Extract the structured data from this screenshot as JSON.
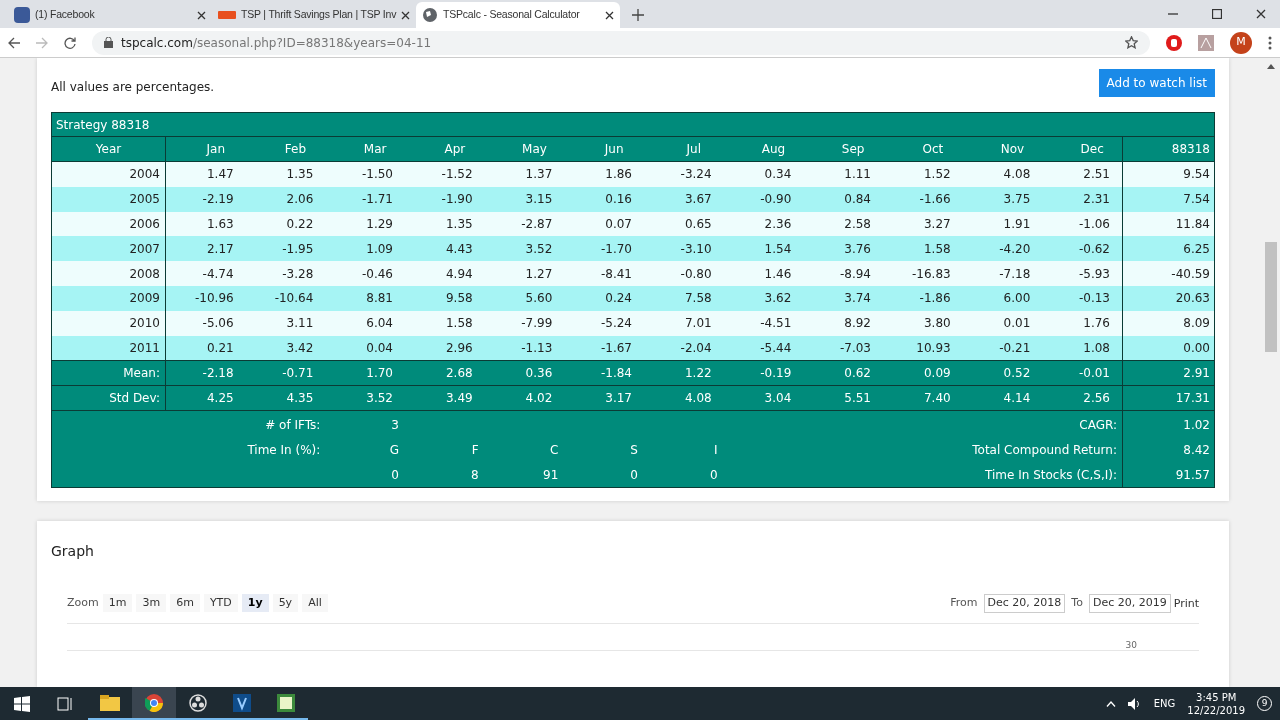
{
  "browser": {
    "tabs": [
      {
        "title": "(1) Facebook",
        "kind": "facebook",
        "selected": false
      },
      {
        "title": "TSP | Thrift Savings Plan | TSP Inv",
        "kind": "tsp",
        "selected": false
      },
      {
        "title": "TSPcalc - Seasonal Calculator",
        "kind": "globe",
        "selected": true
      }
    ],
    "url_host": "tspcalc.com",
    "url_path": "/seasonal.php?ID=88318&years=04-11",
    "profile": "M"
  },
  "page": {
    "note": "All values are percentages.",
    "watch_button": "Add to watch list",
    "table": {
      "title": "Strategy 88318",
      "columns": [
        "Year",
        "Jan",
        "Feb",
        "Mar",
        "Apr",
        "May",
        "Jun",
        "Jul",
        "Aug",
        "Sep",
        "Oct",
        "Nov",
        "Dec",
        "88318"
      ],
      "rows": [
        [
          "2004",
          "1.47",
          "1.35",
          "-1.50",
          "-1.52",
          "1.37",
          "1.86",
          "-3.24",
          "0.34",
          "1.11",
          "1.52",
          "4.08",
          "2.51",
          "9.54"
        ],
        [
          "2005",
          "-2.19",
          "2.06",
          "-1.71",
          "-1.90",
          "3.15",
          "0.16",
          "3.67",
          "-0.90",
          "0.84",
          "-1.66",
          "3.75",
          "2.31",
          "7.54"
        ],
        [
          "2006",
          "1.63",
          "0.22",
          "1.29",
          "1.35",
          "-2.87",
          "0.07",
          "0.65",
          "2.36",
          "2.58",
          "3.27",
          "1.91",
          "-1.06",
          "11.84"
        ],
        [
          "2007",
          "2.17",
          "-1.95",
          "1.09",
          "4.43",
          "3.52",
          "-1.70",
          "-3.10",
          "1.54",
          "3.76",
          "1.58",
          "-4.20",
          "-0.62",
          "6.25"
        ],
        [
          "2008",
          "-4.74",
          "-3.28",
          "-0.46",
          "4.94",
          "1.27",
          "-8.41",
          "-0.80",
          "1.46",
          "-8.94",
          "-16.83",
          "-7.18",
          "-5.93",
          "-40.59"
        ],
        [
          "2009",
          "-10.96",
          "-10.64",
          "8.81",
          "9.58",
          "5.60",
          "0.24",
          "7.58",
          "3.62",
          "3.74",
          "-1.86",
          "6.00",
          "-0.13",
          "20.63"
        ],
        [
          "2010",
          "-5.06",
          "3.11",
          "6.04",
          "1.58",
          "-7.99",
          "-5.24",
          "7.01",
          "-4.51",
          "8.92",
          "3.80",
          "0.01",
          "1.76",
          "8.09"
        ],
        [
          "2011",
          "0.21",
          "3.42",
          "0.04",
          "2.96",
          "-1.13",
          "-1.67",
          "-2.04",
          "-5.44",
          "-7.03",
          "10.93",
          "-0.21",
          "1.08",
          "0.00"
        ]
      ],
      "summary": [
        [
          "Mean:",
          "-2.18",
          "-0.71",
          "1.70",
          "2.68",
          "0.36",
          "-1.84",
          "1.22",
          "-0.19",
          "0.62",
          "0.09",
          "0.52",
          "-0.01",
          "2.91"
        ],
        [
          "Std Dev:",
          "4.25",
          "4.35",
          "3.52",
          "3.49",
          "4.02",
          "3.17",
          "4.08",
          "3.04",
          "5.51",
          "7.40",
          "4.14",
          "2.56",
          "17.31"
        ]
      ],
      "ifts_label": "# of IFTs:",
      "ifts": "3",
      "time_label": "Time In (%):",
      "funds": [
        {
          "fund": "G",
          "time": "0"
        },
        {
          "fund": "F",
          "time": "8"
        },
        {
          "fund": "C",
          "time": "91"
        },
        {
          "fund": "S",
          "time": "0"
        },
        {
          "fund": "I",
          "time": "0"
        }
      ],
      "stats": [
        {
          "label": "CAGR:",
          "value": "1.02"
        },
        {
          "label": "Total Compound Return:",
          "value": "8.42"
        },
        {
          "label": "Time In Stocks (C,S,I):",
          "value": "91.57"
        }
      ]
    },
    "graph": {
      "title": "Graph",
      "zoom_label": "Zoom",
      "zoom_options": [
        {
          "label": "1m",
          "selected": false
        },
        {
          "label": "3m",
          "selected": false
        },
        {
          "label": "6m",
          "selected": false
        },
        {
          "label": "YTD",
          "selected": false
        },
        {
          "label": "1y",
          "selected": true
        },
        {
          "label": "5y",
          "selected": false
        },
        {
          "label": "All",
          "selected": false
        }
      ],
      "from_label": "From",
      "from": "Dec 20, 2018",
      "to_label": "To",
      "to": "Dec 20, 2019",
      "print": "Print",
      "axis_label": "30"
    }
  },
  "taskbar": {
    "apps": [
      {
        "kind": "explorer",
        "active": false
      },
      {
        "kind": "chrome",
        "active": true
      },
      {
        "kind": "obs",
        "active": false
      },
      {
        "kind": "vs",
        "active": false
      },
      {
        "kind": "green",
        "active": false
      }
    ],
    "time": "3:45 PM",
    "date": "12/22/2019",
    "lang": "ENG",
    "notifications": "9"
  }
}
